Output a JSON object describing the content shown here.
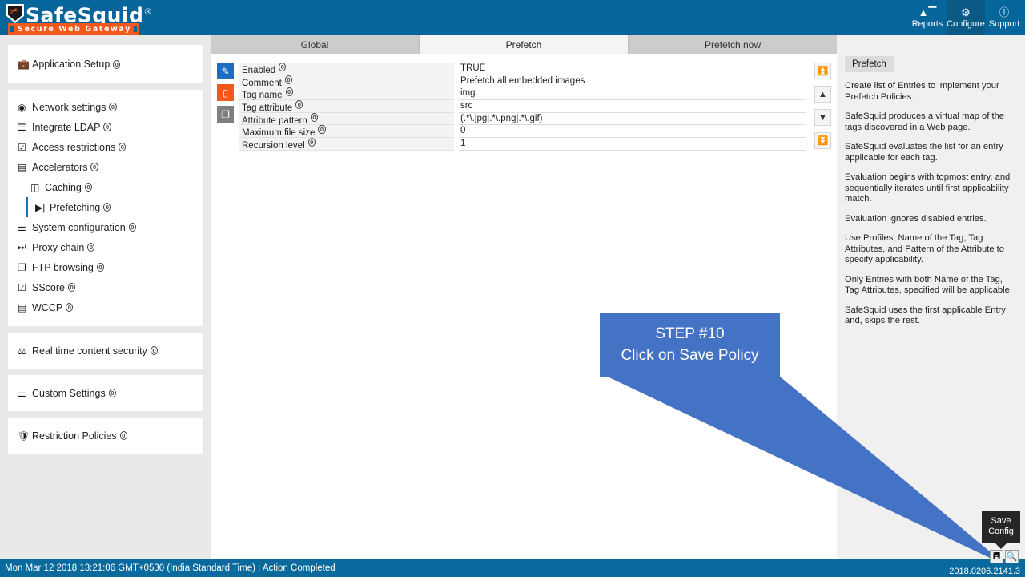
{
  "header": {
    "logo_name": "SafeSquid",
    "logo_reg": "®",
    "logo_tagline": "Secure Web Gateway",
    "nav": [
      {
        "label": "Reports",
        "icon": "chart-icon",
        "active": false
      },
      {
        "label": "Configure",
        "icon": "gears-icon",
        "active": true
      },
      {
        "label": "Support",
        "icon": "question-icon",
        "active": false
      }
    ]
  },
  "sidebar": {
    "app_setup": {
      "label": "Application Setup",
      "icon": "briefcase-icon",
      "info": "0"
    },
    "items": [
      {
        "label": "Network settings",
        "icon": "globe-icon",
        "info": "0"
      },
      {
        "label": "Integrate LDAP",
        "icon": "list-icon",
        "info": "0"
      },
      {
        "label": "Access restrictions",
        "icon": "check-square-icon",
        "info": "0"
      },
      {
        "label": "Accelerators",
        "icon": "server-icon",
        "info": "0"
      },
      {
        "label": "Caching",
        "icon": "database-icon",
        "info": "0"
      },
      {
        "label": "Prefetching",
        "icon": "forward-icon",
        "info": "0"
      },
      {
        "label": "System configuration",
        "icon": "sliders-icon",
        "info": "0"
      },
      {
        "label": "Proxy chain",
        "icon": "fast-forward-icon",
        "info": "0"
      },
      {
        "label": "FTP browsing",
        "icon": "copy-icon",
        "info": "0"
      },
      {
        "label": "SScore",
        "icon": "check-square-icon",
        "info": "0"
      },
      {
        "label": "WCCP",
        "icon": "stack-icon",
        "info": "0"
      }
    ],
    "real_time": {
      "label": "Real time content security",
      "icon": "shield-person-icon",
      "info": "0"
    },
    "custom": {
      "label": "Custom Settings",
      "icon": "sliders-icon",
      "info": "0"
    },
    "restriction": {
      "label": "Restriction Policies",
      "icon": "shield-icon",
      "info": "0"
    }
  },
  "tabs": [
    {
      "label": "Global",
      "active": false
    },
    {
      "label": "Prefetch",
      "active": true
    },
    {
      "label": "Prefetch now",
      "active": false
    }
  ],
  "entry_actions": [
    {
      "name": "edit",
      "icon": "pencil-square-icon"
    },
    {
      "name": "delete",
      "icon": "trash-icon"
    },
    {
      "name": "copy",
      "icon": "copy-icon"
    }
  ],
  "move_controls": [
    {
      "name": "move-to-top",
      "icon": "arrow-up-circle-icon"
    },
    {
      "name": "move-up",
      "icon": "triangle-up-icon"
    },
    {
      "name": "move-down",
      "icon": "triangle-down-icon"
    },
    {
      "name": "move-to-bottom",
      "icon": "arrow-down-circle-icon"
    }
  ],
  "fields": [
    {
      "label": "Enabled",
      "info": "0",
      "value": "TRUE"
    },
    {
      "label": "Comment",
      "info": "0",
      "value": "Prefetch all embedded images"
    },
    {
      "label": "Tag name",
      "info": "0",
      "value": "img"
    },
    {
      "label": "Tag attribute",
      "info": "0",
      "value": "src"
    },
    {
      "label": "Attribute pattern",
      "info": "0",
      "value": "(.*\\.jpg|.*\\.png|.*\\.gif)"
    },
    {
      "label": "Maximum file size",
      "info": "0",
      "value": "0"
    },
    {
      "label": "Recursion level",
      "info": "0",
      "value": "1"
    }
  ],
  "add_button": {
    "label": "+"
  },
  "help": {
    "title": "Prefetch",
    "paragraphs": [
      "Create list of Entries to implement your Prefetch Policies.",
      "SafeSquid produces a virtual map of the tags discovered in a Web page.",
      "SafeSquid evaluates the list for an entry applicable for each tag.",
      "Evaluation begins with topmost entry, and sequentially iterates until first applicability match.",
      "Evaluation ignores disabled entries.",
      "Use Profiles, Name of the Tag, Tag Attributes, and Pattern of the Attribute to specify applicability.",
      "Only Entries with both Name of the Tag, Tag Attributes, specified will be applicable.",
      "SafeSquid uses the first applicable Entry and, skips the rest."
    ]
  },
  "callout": {
    "line1": "STEP #10",
    "line2": "Click on Save Policy",
    "color": "#4472c4"
  },
  "tooltip": {
    "line1": "Save",
    "line2": "Config"
  },
  "bottom_icons": [
    {
      "name": "save-config-icon",
      "glyph": "🖫"
    },
    {
      "name": "search-icon",
      "glyph": "🔍"
    }
  ],
  "statusbar": {
    "text": "Mon Mar 12 2018 13:21:06 GMT+0530 (India Standard Time) : Action Completed"
  },
  "version": {
    "text": "2018.0206.2141.3"
  },
  "colors": {
    "header": "#06669c",
    "accent_orange": "#f2581b",
    "callout": "#4472c4",
    "status": "#0a6a9e"
  }
}
